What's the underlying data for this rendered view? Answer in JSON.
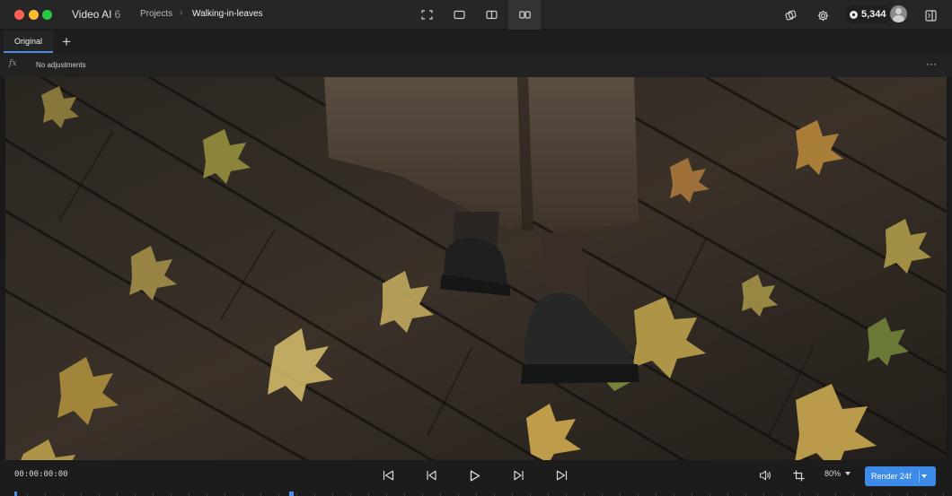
{
  "app": {
    "name": "Video AI",
    "version": "6"
  },
  "breadcrumb": {
    "projects": "Projects",
    "separator": "›",
    "current": "Walking-in-leaves"
  },
  "view_modes": [
    {
      "name": "fullscreen-view-icon",
      "active": false
    },
    {
      "name": "single-view-icon",
      "active": false
    },
    {
      "name": "split-view-icon",
      "active": false
    },
    {
      "name": "side-by-side-view-icon",
      "active": true
    }
  ],
  "header": {
    "credits": "5,344"
  },
  "tabs": {
    "original": "Original",
    "add": "+"
  },
  "adjustments": {
    "fx": "fx",
    "label": "No adjustments",
    "more": "···"
  },
  "player": {
    "timecode": "00:00:00:00",
    "zoom": "80%",
    "render_label": "Render 24f"
  },
  "colors": {
    "accent": "#3d8be8",
    "titlebar": "#262626",
    "background": "#1a1a1a"
  }
}
